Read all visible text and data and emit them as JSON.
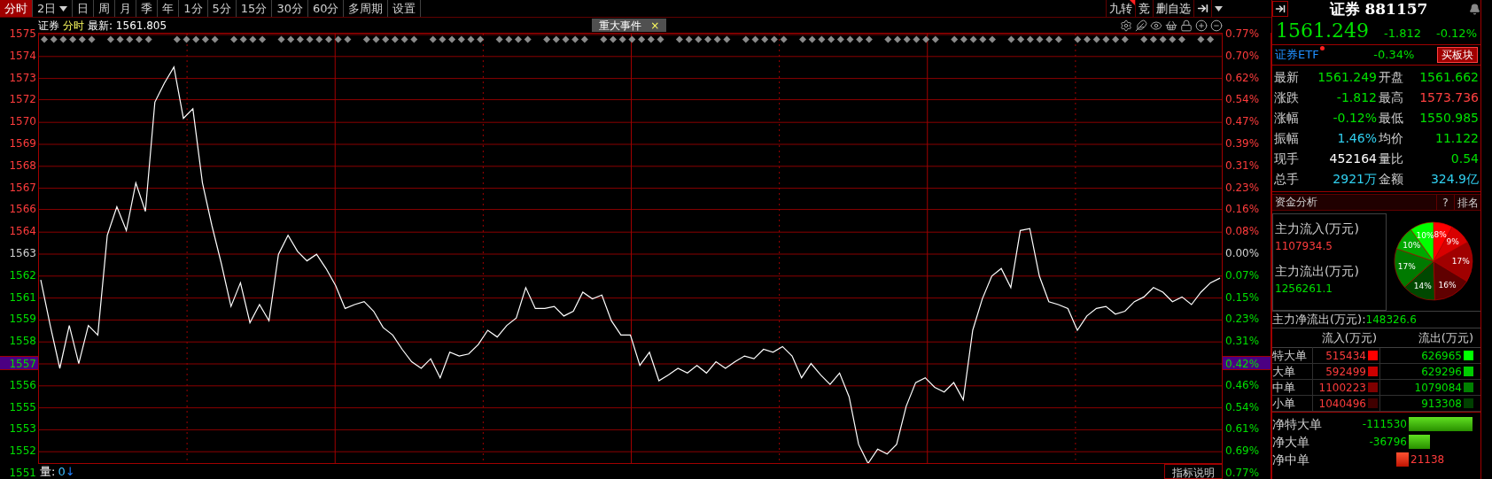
{
  "toolbar": {
    "tabs": [
      {
        "label": "分时",
        "selected": true,
        "kind": "tab"
      },
      {
        "label": "2日",
        "selected": false,
        "kind": "dropdown"
      },
      {
        "label": "日",
        "selected": false,
        "kind": "tab"
      },
      {
        "label": "周",
        "selected": false,
        "kind": "tab"
      },
      {
        "label": "月",
        "selected": false,
        "kind": "tab"
      },
      {
        "label": "季",
        "selected": false,
        "kind": "tab"
      },
      {
        "label": "年",
        "selected": false,
        "kind": "tab"
      },
      {
        "label": "1分",
        "selected": false,
        "kind": "tab"
      },
      {
        "label": "5分",
        "selected": false,
        "kind": "tab"
      },
      {
        "label": "15分",
        "selected": false,
        "kind": "tab"
      },
      {
        "label": "30分",
        "selected": false,
        "kind": "tab"
      },
      {
        "label": "60分",
        "selected": false,
        "kind": "tab"
      },
      {
        "label": "多周期",
        "selected": false,
        "kind": "tab"
      },
      {
        "label": "设置",
        "selected": false,
        "kind": "tab"
      }
    ],
    "tools": [
      {
        "label": "九转",
        "flagged": true
      },
      {
        "label": "竞",
        "flagged": false
      },
      {
        "label": "删自选",
        "flagged": false
      }
    ]
  },
  "chart_header": {
    "name": "证券",
    "period": "分时",
    "latest": "最新: 1561.805",
    "event_tag": "重大事件",
    "event_close": "×"
  },
  "chart": {
    "chart_data": {
      "type": "line",
      "grid": true,
      "ylim": [
        1551.06,
        1575.06
      ],
      "yticks": [
        {
          "value": 1575.06,
          "label": "1575"
        },
        {
          "value": 1573.86,
          "label": "1574"
        },
        {
          "value": 1572.66,
          "label": "1573"
        },
        {
          "value": 1571.5,
          "label": "1572"
        },
        {
          "value": 1570.26,
          "label": "1570"
        },
        {
          "value": 1569.06,
          "label": "1569"
        },
        {
          "value": 1567.86,
          "label": "1568"
        },
        {
          "value": 1566.66,
          "label": "1567"
        },
        {
          "value": 1565.5,
          "label": "1566"
        },
        {
          "value": 1564.26,
          "label": "1564"
        },
        {
          "value": 1563.06,
          "label": "1563"
        },
        {
          "value": 1561.86,
          "label": "1562"
        },
        {
          "value": 1560.66,
          "label": "1561"
        },
        {
          "value": 1559.46,
          "label": "1559"
        },
        {
          "value": 1558.26,
          "label": "1558"
        },
        {
          "value": 1555.86,
          "label": "1556"
        },
        {
          "value": 1554.66,
          "label": "1555"
        },
        {
          "value": 1553.46,
          "label": "1553"
        },
        {
          "value": 1552.26,
          "label": "1552"
        },
        {
          "value": 1551.06,
          "label": "1551"
        }
      ],
      "categories": [
        null,
        null,
        null,
        null,
        null,
        null,
        null,
        null,
        null,
        null,
        null,
        null,
        null,
        null,
        null,
        null,
        null,
        null,
        null,
        null,
        null,
        null,
        null,
        null,
        null,
        null,
        null,
        null,
        null,
        null,
        null,
        null,
        null,
        null,
        null,
        null,
        null,
        null,
        null,
        null,
        null,
        null,
        null,
        null,
        null,
        null,
        null,
        null,
        null,
        null,
        null,
        null,
        null,
        null,
        null,
        null,
        null,
        null,
        null,
        null,
        null,
        null,
        null,
        null,
        null,
        null,
        null,
        null,
        null,
        null,
        null,
        null,
        null,
        null,
        null,
        null,
        null,
        null,
        null,
        null,
        null,
        null,
        null,
        null,
        null,
        null,
        null,
        null,
        null,
        null,
        null,
        null,
        null,
        null,
        null,
        null,
        null,
        null,
        null,
        null,
        null,
        null,
        null,
        null,
        null,
        null,
        null,
        null,
        null,
        null,
        null,
        null,
        null,
        null,
        null,
        null,
        null,
        null,
        null,
        null,
        null,
        null,
        null,
        null,
        null
      ],
      "series": [
        {
          "color": "#ffffff",
          "values": [
            1561.65,
            1559.16,
            1556.82,
            1559.16,
            1557.08,
            1559.16,
            1558.64,
            1564.09,
            1565.65,
            1564.35,
            1566.95,
            1565.39,
            1571.37,
            1572.4,
            1573.29,
            1570.48,
            1571.0,
            1566.95,
            1564.61,
            1562.53,
            1560.2,
            1561.49,
            1559.31,
            1560.3,
            1559.42,
            1563.05,
            1564.09,
            1563.21,
            1562.69,
            1563.05,
            1562.27,
            1561.34,
            1560.09,
            1560.3,
            1560.46,
            1559.94,
            1559.05,
            1558.64,
            1557.86,
            1557.18,
            1556.82,
            1557.34,
            1556.3,
            1557.7,
            1557.49,
            1557.6,
            1558.12,
            1558.9,
            1558.53,
            1559.16,
            1559.57,
            1561.23,
            1560.09,
            1560.09,
            1560.2,
            1559.68,
            1559.94,
            1560.98,
            1560.61,
            1560.82,
            1559.42,
            1558.64,
            1558.64,
            1556.98,
            1557.7,
            1556.14,
            1556.46,
            1556.82,
            1556.56,
            1556.98,
            1556.56,
            1557.18,
            1556.82,
            1557.18,
            1557.49,
            1557.34,
            1557.86,
            1557.7,
            1558.01,
            1557.49,
            1556.3,
            1557.08,
            1556.46,
            1555.94,
            1556.56,
            1555.26,
            1552.66,
            1551.62,
            1552.4,
            1552.14,
            1552.66,
            1554.74,
            1556.04,
            1556.3,
            1555.78,
            1555.52,
            1556.04,
            1555.1,
            1558.9,
            1560.61,
            1561.86,
            1562.27,
            1561.23,
            1564.35,
            1564.46,
            1561.86,
            1560.46,
            1560.3,
            1560.09,
            1558.9,
            1559.68,
            1560.09,
            1560.2,
            1559.78,
            1559.94,
            1560.46,
            1560.72,
            1561.23,
            1560.98,
            1560.46,
            1560.72,
            1560.3,
            1560.98,
            1561.49,
            1561.75
          ]
        }
      ]
    },
    "cursor": {
      "price": "1557",
      "percent": "0.42%"
    },
    "percent_axis": [
      {
        "label": "0.77%",
        "color": "#ff3c3c"
      },
      {
        "label": "0.70%",
        "color": "#ff3c3c"
      },
      {
        "label": "0.62%",
        "color": "#ff3c3c"
      },
      {
        "label": "0.54%",
        "color": "#ff3c3c"
      },
      {
        "label": "0.47%",
        "color": "#ff3c3c"
      },
      {
        "label": "0.39%",
        "color": "#ff3c3c"
      },
      {
        "label": "0.31%",
        "color": "#ff3c3c"
      },
      {
        "label": "0.23%",
        "color": "#ff3c3c"
      },
      {
        "label": "0.16%",
        "color": "#ff3c3c"
      },
      {
        "label": "0.08%",
        "color": "#ff3c3c"
      },
      {
        "label": "0.00%",
        "color": "#d0d0d0"
      },
      {
        "label": "0.07%",
        "color": "#00e000"
      },
      {
        "label": "0.15%",
        "color": "#00e000"
      },
      {
        "label": "0.23%",
        "color": "#00e000"
      },
      {
        "label": "0.31%",
        "color": "#00e000"
      },
      {
        "label": "0.46%",
        "color": "#00e000"
      },
      {
        "label": "0.54%",
        "color": "#00e000"
      },
      {
        "label": "0.61%",
        "color": "#00e000"
      },
      {
        "label": "0.69%",
        "color": "#00e000"
      },
      {
        "label": "0.77%",
        "color": "#00e000"
      }
    ],
    "volume": {
      "label": "量:",
      "value": "0",
      "arrow": "↓"
    },
    "indicator_button": "指标说明"
  },
  "quote": {
    "title": "证券 881157",
    "price": "1561.249",
    "change": "-1.812",
    "change_pct": "-0.12%",
    "etf": {
      "name": "证券ETF",
      "alert": true,
      "change": "-0.34%",
      "button": "买板块"
    },
    "stats": [
      {
        "cells": [
          {
            "label": "最新",
            "value": "1561.249",
            "color": "#00e000"
          },
          {
            "label": "开盘",
            "value": "1561.662",
            "color": "#00e000"
          }
        ]
      },
      {
        "cells": [
          {
            "label": "涨跌",
            "value": "-1.812",
            "color": "#00e000"
          },
          {
            "label": "最高",
            "value": "1573.736",
            "color": "#ff4040"
          }
        ]
      },
      {
        "cells": [
          {
            "label": "涨幅",
            "value": "-0.12%",
            "color": "#00e000"
          },
          {
            "label": "最低",
            "value": "1550.985",
            "color": "#00e000"
          }
        ]
      },
      {
        "cells": [
          {
            "label": "振幅",
            "value": "1.46%",
            "color": "#30d0f0"
          },
          {
            "label": "均价",
            "value": "11.122",
            "color": "#00e000"
          }
        ]
      },
      {
        "cells": [
          {
            "label": "现手",
            "value": "452164",
            "color": "#ffffff"
          },
          {
            "label": "量比",
            "value": "0.54",
            "color": "#00e000"
          }
        ]
      },
      {
        "cells": [
          {
            "label": "总手",
            "value": "2921万",
            "color": "#30d0f0"
          },
          {
            "label": "金额",
            "value": "324.9亿",
            "color": "#30d0f0"
          }
        ]
      }
    ]
  },
  "fund_analysis": {
    "title": "资金分析",
    "help": "?",
    "rank": "排名",
    "inflow_label": "主力流入(万元)",
    "inflow": "1107934.5",
    "outflow_label": "主力流出(万元)",
    "outflow": "1256261.1",
    "pie": {
      "chart_data": {
        "type": "pie",
        "values": [
          8,
          9,
          17,
          16,
          14,
          17,
          10,
          10
        ],
        "colors": [
          "#ff0000",
          "#d80000",
          "#a00000",
          "#600000",
          "#004800",
          "#007a00",
          "#00a800",
          "#00ff00"
        ],
        "value_labels": [
          "8%",
          "9%",
          "17%",
          "16%",
          "14%",
          "17%",
          "10%",
          "10%"
        ],
        "data_labels": true
      }
    },
    "net_label": "主力净流出(万元):",
    "net": "148326.6",
    "columns": [
      "流入(万元)",
      "流出(万元)"
    ],
    "orders": [
      {
        "name": "特大单",
        "flows": [
          {
            "value": "515434",
            "color": "#ff0000"
          },
          {
            "value": "626965",
            "color": "#00ff00"
          }
        ]
      },
      {
        "name": "大单",
        "flows": [
          {
            "value": "592499",
            "color": "#cc0000"
          },
          {
            "value": "629296",
            "color": "#00cc00"
          }
        ]
      },
      {
        "name": "中单",
        "flows": [
          {
            "value": "1100223",
            "color": "#800000"
          },
          {
            "value": "1079084",
            "color": "#008000"
          }
        ]
      },
      {
        "name": "小单",
        "flows": [
          {
            "value": "1040496",
            "color": "#400000"
          },
          {
            "value": "913308",
            "color": "#004000"
          }
        ]
      }
    ],
    "net_orders": [
      {
        "name": "净特大单",
        "value": "-111530",
        "kind": "outflow"
      },
      {
        "name": "净大单",
        "value": "-36796",
        "kind": "outflow"
      },
      {
        "name": "净中单",
        "value": "21138",
        "kind": "inflow"
      }
    ]
  }
}
